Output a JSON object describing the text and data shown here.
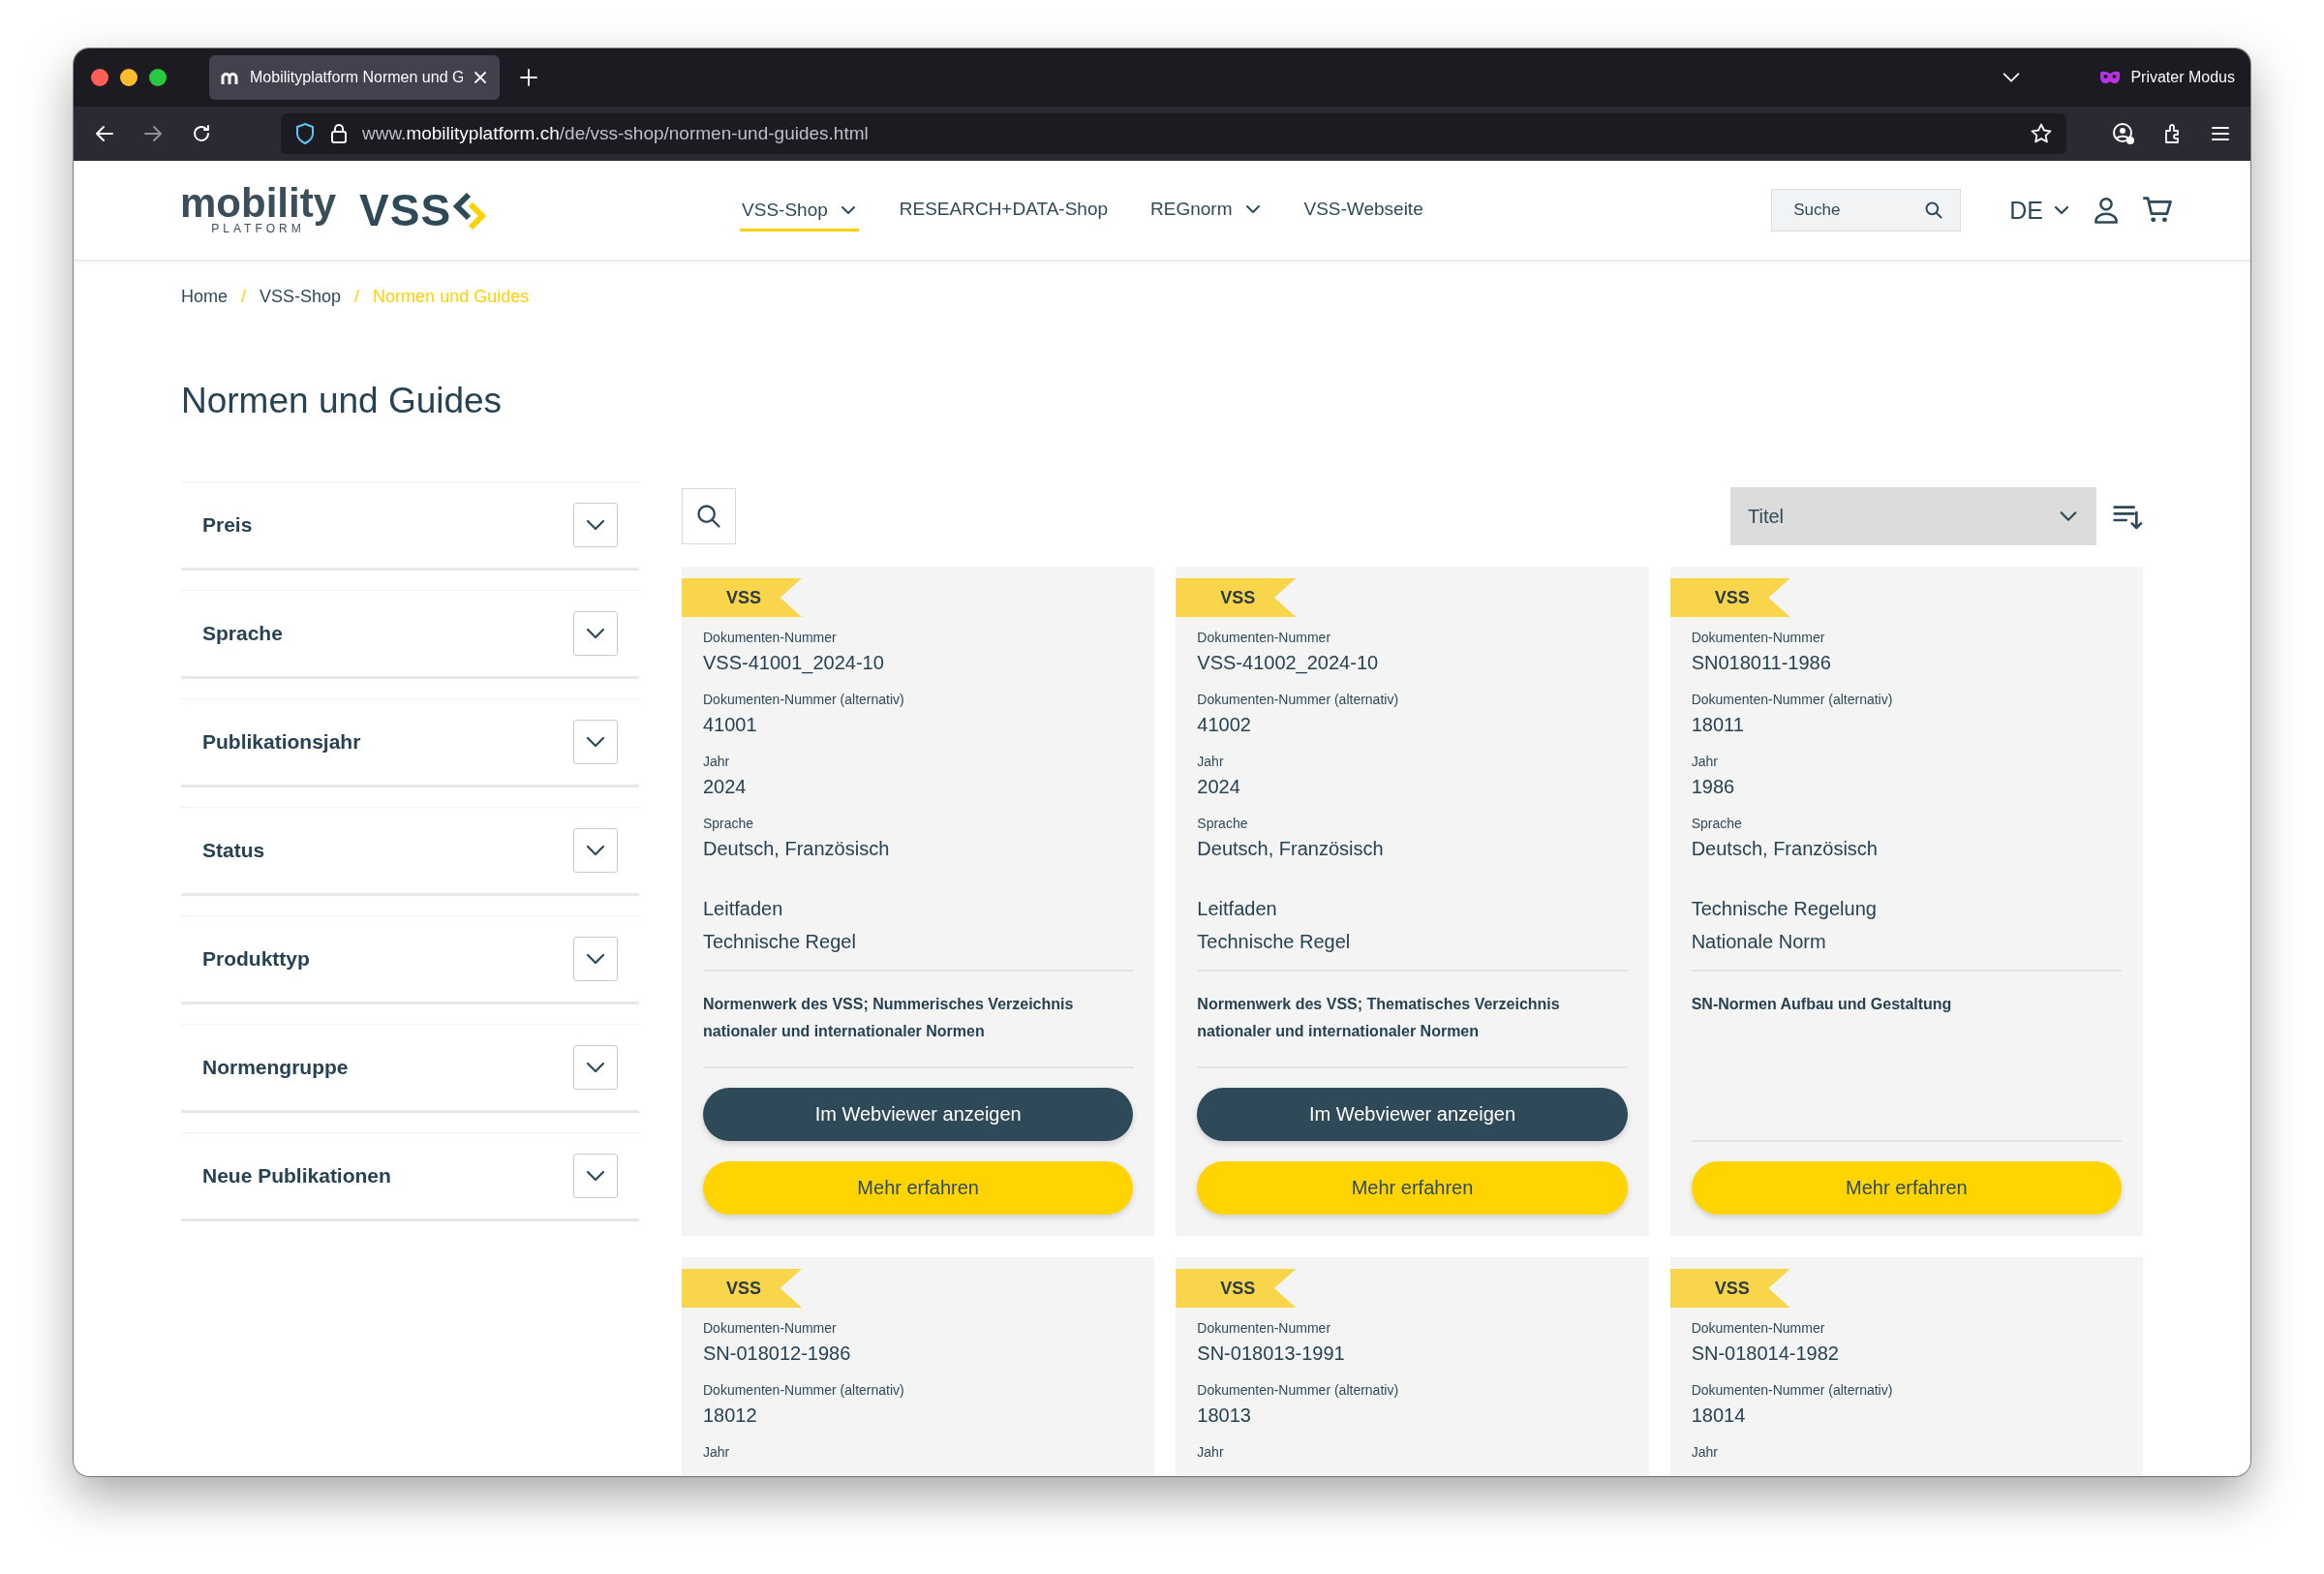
{
  "browser": {
    "tab_title": "Mobilityplatform Normen und G",
    "private_label": "Privater Modus",
    "forward_disabled": true,
    "url": {
      "prefix": "www.",
      "domain": "mobilityplatform.ch",
      "path": "/de/vss-shop/normen-und-guides.html"
    }
  },
  "header": {
    "logo": {
      "word": "mobility",
      "sub": "PLATFORM"
    },
    "brand": "VSS",
    "nav": [
      {
        "label": "VSS-Shop",
        "selected": true,
        "has_menu": true
      },
      {
        "label": "RESEARCH+DATA-Shop",
        "selected": false,
        "has_menu": false
      },
      {
        "label": "REGnorm",
        "selected": false,
        "has_menu": true
      },
      {
        "label": "VSS-Webseite",
        "selected": false,
        "has_menu": false
      }
    ],
    "search": {
      "placeholder": "Suche"
    },
    "language": "DE"
  },
  "breadcrumb": [
    {
      "label": "Home",
      "selected": false
    },
    {
      "label": "VSS-Shop",
      "selected": false
    },
    {
      "label": "Normen und Guides",
      "selected": true
    }
  ],
  "breadcrumb_separator": "/",
  "page_title": "Normen und Guides",
  "filters": [
    {
      "label": "Preis",
      "expanded": false
    },
    {
      "label": "Sprache",
      "expanded": false
    },
    {
      "label": "Publikationsjahr",
      "expanded": false
    },
    {
      "label": "Status",
      "expanded": false
    },
    {
      "label": "Produkttyp",
      "expanded": false
    },
    {
      "label": "Normengruppe",
      "expanded": false
    },
    {
      "label": "Neue Publikationen",
      "expanded": false
    }
  ],
  "sort": {
    "value": "Titel"
  },
  "cards": [
    {
      "badge": "VSS",
      "fields": [
        {
          "label": "Dokumenten-Nummer",
          "value": "VSS-41001_2024-10"
        },
        {
          "label": "Dokumenten-Nummer (alternativ)",
          "value": "41001"
        },
        {
          "label": "Jahr",
          "value": "2024"
        },
        {
          "label": "Sprache",
          "value": "Deutsch, Französisch"
        }
      ],
      "types": [
        "Leitfaden",
        "Technische Regel"
      ],
      "title": "Normenwerk des VSS; Nummerisches Verzeichnis nationaler und internationaler Normen",
      "buttons": [
        {
          "kind": "dark",
          "label": "Im Webviewer anzeigen"
        },
        {
          "kind": "yellow",
          "label": "Mehr erfahren"
        }
      ]
    },
    {
      "badge": "VSS",
      "fields": [
        {
          "label": "Dokumenten-Nummer",
          "value": "VSS-41002_2024-10"
        },
        {
          "label": "Dokumenten-Nummer (alternativ)",
          "value": "41002"
        },
        {
          "label": "Jahr",
          "value": "2024"
        },
        {
          "label": "Sprache",
          "value": "Deutsch, Französisch"
        }
      ],
      "types": [
        "Leitfaden",
        "Technische Regel"
      ],
      "title": "Normenwerk des VSS; Thematisches Verzeichnis nationaler und internationaler Normen",
      "buttons": [
        {
          "kind": "dark",
          "label": "Im Webviewer anzeigen"
        },
        {
          "kind": "yellow",
          "label": "Mehr erfahren"
        }
      ]
    },
    {
      "badge": "VSS",
      "fields": [
        {
          "label": "Dokumenten-Nummer",
          "value": "SN018011-1986"
        },
        {
          "label": "Dokumenten-Nummer (alternativ)",
          "value": "18011"
        },
        {
          "label": "Jahr",
          "value": "1986"
        },
        {
          "label": "Sprache",
          "value": "Deutsch, Französisch"
        }
      ],
      "types": [
        "Technische Regelung",
        "Nationale Norm"
      ],
      "title": "SN-Normen Aufbau und Gestaltung",
      "buttons": [
        {
          "kind": "yellow",
          "label": "Mehr erfahren"
        }
      ]
    },
    {
      "badge": "VSS",
      "fields": [
        {
          "label": "Dokumenten-Nummer",
          "value": "SN-018012-1986"
        },
        {
          "label": "Dokumenten-Nummer (alternativ)",
          "value": "18012"
        },
        {
          "label": "Jahr"
        }
      ]
    },
    {
      "badge": "VSS",
      "fields": [
        {
          "label": "Dokumenten-Nummer",
          "value": "SN-018013-1991"
        },
        {
          "label": "Dokumenten-Nummer (alternativ)",
          "value": "18013"
        },
        {
          "label": "Jahr"
        }
      ]
    },
    {
      "badge": "VSS",
      "fields": [
        {
          "label": "Dokumenten-Nummer",
          "value": "SN-018014-1982"
        },
        {
          "label": "Dokumenten-Nummer (alternativ)",
          "value": "18014"
        },
        {
          "label": "Jahr"
        }
      ]
    }
  ]
}
